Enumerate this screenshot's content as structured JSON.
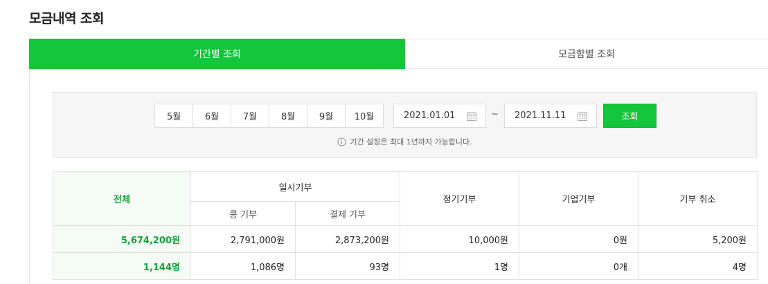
{
  "page_title": "모금내역 조회",
  "tabs": [
    {
      "label": "기간별 조회",
      "active": true
    },
    {
      "label": "모금함별 조회",
      "active": false
    }
  ],
  "filter": {
    "months": [
      "5월",
      "6월",
      "7월",
      "8월",
      "9월",
      "10월"
    ],
    "date_from": "2021.01.01",
    "date_to": "2021.11.11",
    "tilde": "~",
    "search_label": "조회",
    "notice": "기간 설정은 최대 1년까지 가능합니다."
  },
  "table": {
    "total_label": "전체",
    "group_onetime": "일시기부",
    "sub_headers": [
      "콩 기부",
      "결제 기부"
    ],
    "headers": [
      "정기기부",
      "기업기부",
      "기부 취소"
    ],
    "rows": [
      [
        "5,674,200원",
        "2,791,000원",
        "2,873,200원",
        "10,000원",
        "0원",
        "5,200원"
      ],
      [
        "1,144명",
        "1,086명",
        "93명",
        "1명",
        "0개",
        "4명"
      ]
    ]
  },
  "colors": {
    "accent": "#13c63c",
    "accent_text": "#13a33a"
  }
}
